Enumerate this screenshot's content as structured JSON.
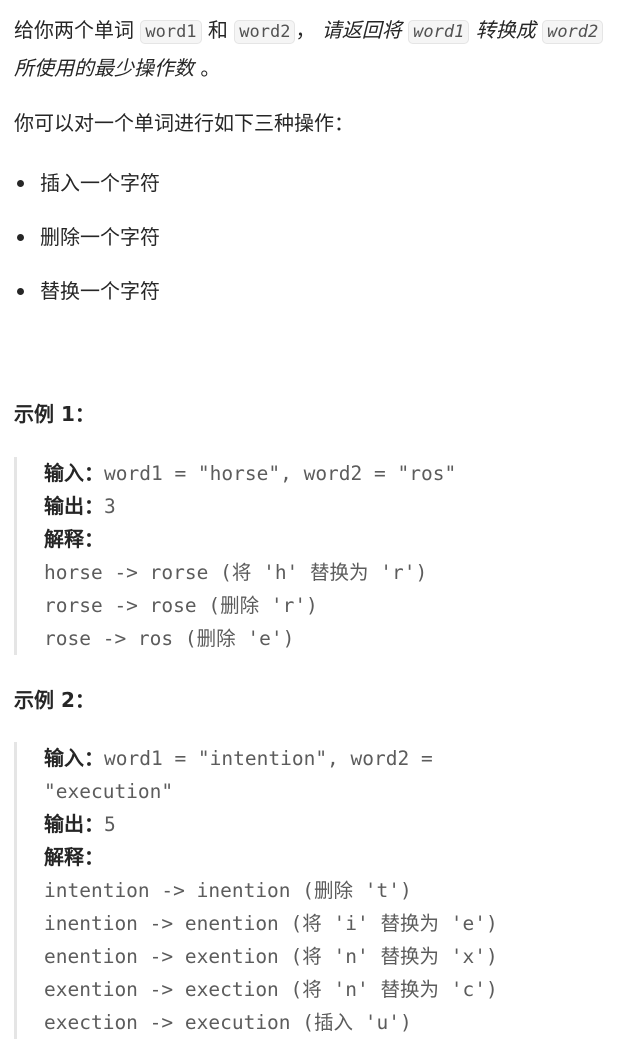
{
  "intro": {
    "part1": "给你两个单词 ",
    "code1": "word1",
    "part2": " 和 ",
    "code2": "word2",
    "part3": "，",
    "part4": " 请返回将 ",
    "code3": "word1",
    "part5": " 转换成 ",
    "code4": "word2",
    "part6": " 所使用的最少操作数",
    "part7": " 。"
  },
  "ops_lead": "你可以对一个单词进行如下三种操作：",
  "ops": [
    "插入一个字符",
    "删除一个字符",
    "替换一个字符"
  ],
  "examples": [
    {
      "title": "示例 1：",
      "input_label": "输入：",
      "input_value": "word1 = \"horse\", word2 = \"ros\"",
      "output_label": "输出：",
      "output_value": "3",
      "explain_label": "解释：",
      "steps": [
        "horse -> rorse (将 'h' 替换为 'r')",
        "rorse -> rose (删除 'r')",
        "rose -> ros (删除 'e')"
      ]
    },
    {
      "title": "示例 2：",
      "input_label": "输入：",
      "input_value_line1": "word1 = \"intention\", word2 =",
      "input_value_line2": "\"execution\"",
      "output_label": "输出：",
      "output_value": "5",
      "explain_label": "解释：",
      "steps": [
        "intention -> inention (删除 't')",
        "inention -> enention (将 'i' 替换为 'e')",
        "enention -> exention (将 'n' 替换为 'x')",
        "exention -> exection (将 'n' 替换为 'c')",
        "exection -> execution (插入 'u')"
      ]
    }
  ]
}
